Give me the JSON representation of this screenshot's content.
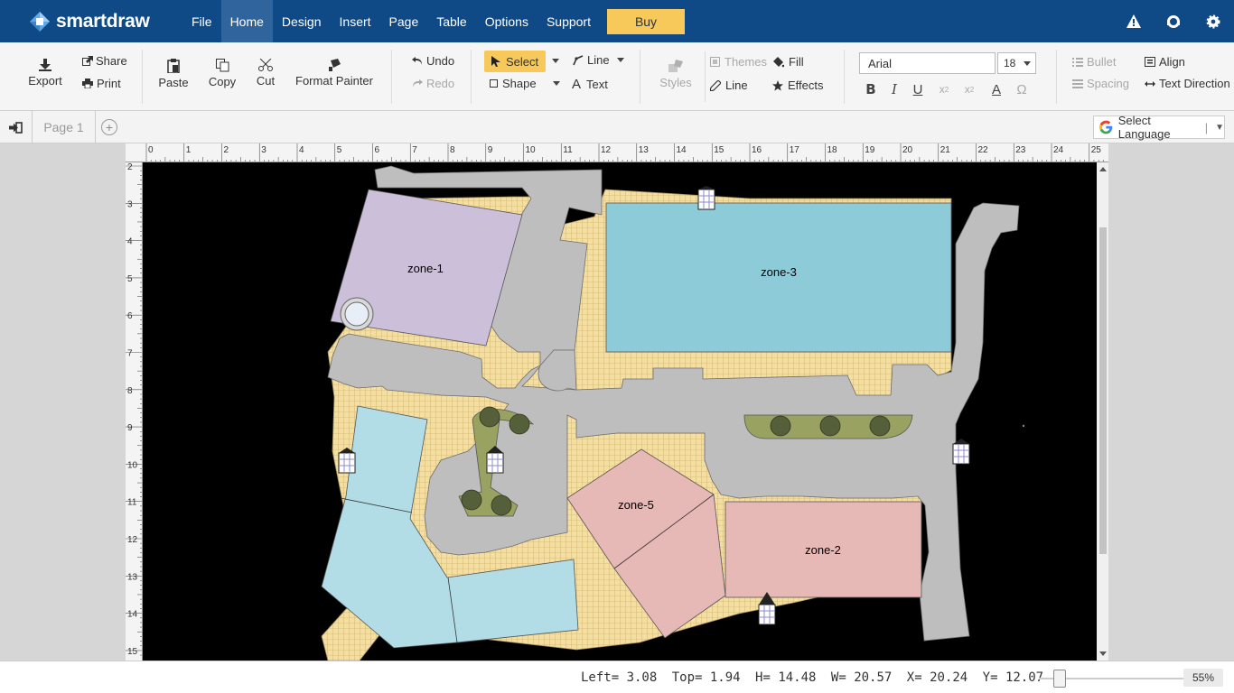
{
  "app": {
    "logo_text": "smartdraw",
    "menu": [
      "File",
      "Home",
      "Design",
      "Insert",
      "Page",
      "Table",
      "Options",
      "Support"
    ],
    "active_menu": "Home",
    "buy_label": "Buy",
    "brand_color": "#0f4a87",
    "accent_color": "#f7c85a"
  },
  "ribbon": {
    "export": "Export",
    "share": "Share",
    "print": "Print",
    "paste": "Paste",
    "copy": "Copy",
    "cut": "Cut",
    "format_painter": "Format Painter",
    "undo": "Undo",
    "redo": "Redo",
    "select": "Select",
    "line": "Line",
    "shape": "Shape",
    "text": "Text",
    "styles": "Styles",
    "themes": "Themes",
    "fill": "Fill",
    "line_style": "Line",
    "effects": "Effects",
    "font_name": "Arial",
    "font_size": "18",
    "bullet": "Bullet",
    "spacing": "Spacing",
    "align": "Align",
    "text_direction": "Text Direction"
  },
  "pages": {
    "tab_label": "Page 1",
    "language_label": "Select Language"
  },
  "canvas": {
    "ruler_top_labels": [
      "0",
      "1",
      "2",
      "3",
      "4",
      "5",
      "6",
      "7",
      "8",
      "9",
      "10",
      "11",
      "12",
      "13",
      "14",
      "15",
      "16",
      "17",
      "18",
      "19",
      "20",
      "21",
      "22",
      "23",
      "24",
      "25"
    ],
    "ruler_left_labels": [
      "2",
      "3",
      "4",
      "5",
      "6",
      "7",
      "8",
      "9",
      "10",
      "11",
      "12",
      "13",
      "14",
      "15"
    ],
    "zones": [
      "zone-1",
      "zone-2",
      "zone-3",
      "zone-5"
    ],
    "colors": {
      "zone1": "#cbbfd9",
      "zone2": "#e6b8b6",
      "zone3": "#8ecbd8",
      "zone4": "#b2dde6",
      "road": "#bebebe",
      "hatch": "#f3dfa3",
      "planter": "#9aa262"
    }
  },
  "status": {
    "left": "Left= 3.08",
    "top": "Top= 1.94",
    "h": "H= 14.48",
    "w": "W= 20.57",
    "x": "X= 20.24",
    "y": "Y= 12.07",
    "zoom": "55%",
    "zoom_level": 0.55
  }
}
